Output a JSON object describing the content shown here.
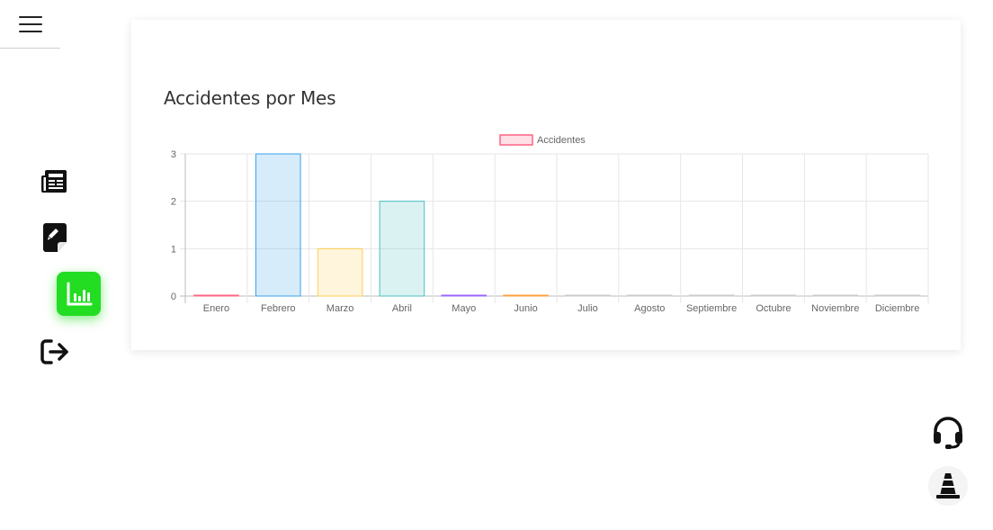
{
  "nav": {
    "menu_icon": "hamburger-icon",
    "items": [
      {
        "name": "news",
        "icon": "newspaper-icon",
        "active": false
      },
      {
        "name": "report",
        "icon": "document-edit-icon",
        "active": false
      },
      {
        "name": "stats",
        "icon": "chart-icon",
        "active": true
      },
      {
        "name": "logout",
        "icon": "logout-icon",
        "active": false
      }
    ],
    "active_color": "#22dd22"
  },
  "floating": {
    "support_icon": "headset-icon",
    "cone_icon": "traffic-cone-icon"
  },
  "card": {
    "title": "Accidentes por Mes"
  },
  "chart_data": {
    "type": "bar",
    "categories": [
      "Enero",
      "Febrero",
      "Marzo",
      "Abril",
      "Mayo",
      "Junio",
      "Julio",
      "Agosto",
      "Septiembre",
      "Octubre",
      "Noviembre",
      "Diciembre"
    ],
    "series": [
      {
        "name": "Accidentes",
        "values": [
          0,
          3,
          1,
          2,
          0,
          0,
          0,
          0,
          0,
          0,
          0,
          0
        ],
        "fills": [
          "rgba(255,99,132,0.2)",
          "rgba(54,162,235,0.2)",
          "rgba(255,206,86,0.2)",
          "rgba(75,192,192,0.2)",
          "rgba(153,102,255,0.2)",
          "rgba(255,159,64,0.2)",
          "rgba(201,203,207,0.2)",
          "rgba(201,203,207,0.2)",
          "rgba(201,203,207,0.2)",
          "rgba(201,203,207,0.2)",
          "rgba(201,203,207,0.2)",
          "rgba(201,203,207,0.2)"
        ],
        "borders": [
          "#ff6384",
          "#36a2eb",
          "#ffce56",
          "#4bc0c0",
          "#9966ff",
          "#ff9f40",
          "#c9cbcf",
          "#c9cbcf",
          "#c9cbcf",
          "#c9cbcf",
          "#c9cbcf",
          "#c9cbcf"
        ]
      }
    ],
    "yticks": [
      "0",
      "1",
      "2",
      "3"
    ],
    "ylim": [
      0,
      3
    ],
    "legend": {
      "label": "Accidentes",
      "fill": "rgba(255,99,132,0.2)",
      "border": "#ff6384",
      "position": "top"
    },
    "grid": true,
    "xlabel": "",
    "ylabel": ""
  }
}
